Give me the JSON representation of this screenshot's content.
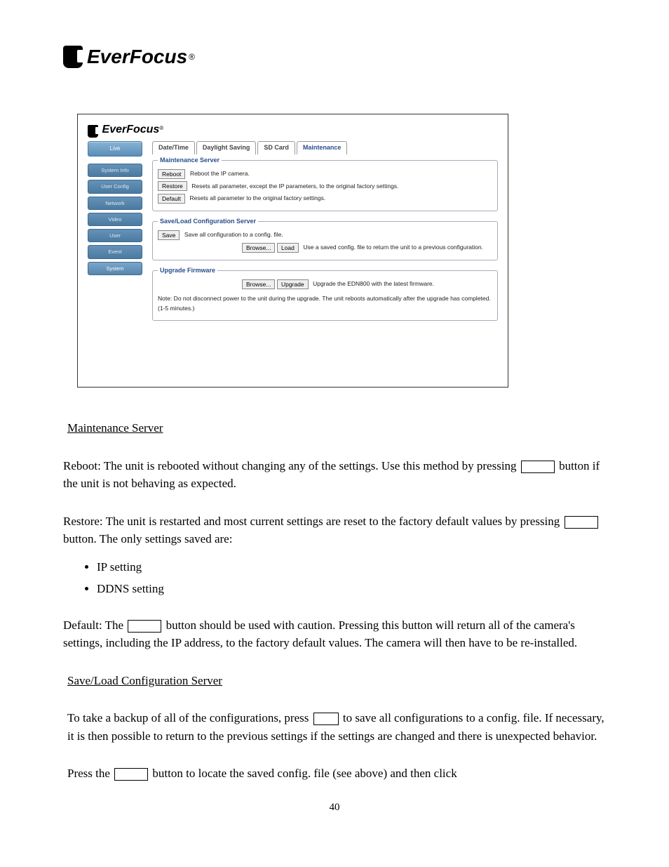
{
  "header": {
    "brand": "EverFocus"
  },
  "panel": {
    "brand": "EverFocus",
    "sidebar": {
      "live": "Live",
      "items": [
        "System Info",
        "User Config",
        "Network",
        "Video",
        "User",
        "Event",
        "System"
      ]
    },
    "tabs": [
      "Date/Time",
      "Daylight Saving",
      "SD Card",
      "Maintenance"
    ],
    "activeTab": "Maintenance",
    "maintenance": {
      "legend": "Maintenance Server",
      "reboot_btn": "Reboot",
      "reboot_desc": "Reboot the IP camera.",
      "restore_btn": "Restore",
      "restore_desc": "Resets all parameter, except the IP parameters, to the original factory settings.",
      "default_btn": "Default",
      "default_desc": "Resets all parameter to the original factory settings."
    },
    "saveload": {
      "legend": "Save/Load Configuration Server",
      "save_btn": "Save",
      "save_desc": "Save all configuration to a config. file.",
      "browse_btn": "Browse...",
      "load_btn": "Load",
      "load_desc": "Use a saved config. file to return the unit to a previous configuration."
    },
    "upgrade": {
      "legend": "Upgrade Firmware",
      "browse_btn": "Browse...",
      "upgrade_btn": "Upgrade",
      "upgrade_desc": "Upgrade the EDN800 with the latest firmware.",
      "note": "Note: Do not disconnect power to the unit during the upgrade. The unit reboots automatically after the upgrade has completed. (1-5 minutes.)"
    }
  },
  "doc": {
    "h_maint": "Maintenance Server",
    "reboot_pre": "Reboot: The unit is rebooted without changing any of the settings. Use this method by pressing ",
    "reboot_post": " button if the unit is not behaving as expected.",
    "restore_pre": "Restore: The unit is restarted and most current settings are reset to the factory default values by pressing ",
    "restore_post": " button. The only settings saved are:",
    "bullet1": "IP setting",
    "bullet2": "DDNS setting",
    "default_pre": "Default: The ",
    "default_post": " button should be used with caution. Pressing this button will return all of the camera's settings, including the IP address, to the factory default values. The camera will then have to be re-installed.",
    "h_saveload": "Save/Load Configuration Server",
    "saveload_pre": "To take a backup of all of the configurations, press ",
    "saveload_post": " to save all configurations to a config. file. If necessary, it is then possible to return to the previous settings if the settings are changed and there is unexpected behavior.",
    "press_pre": "Press the ",
    "press_post": " button to locate the saved config. file (see above) and then click",
    "page": "40"
  }
}
